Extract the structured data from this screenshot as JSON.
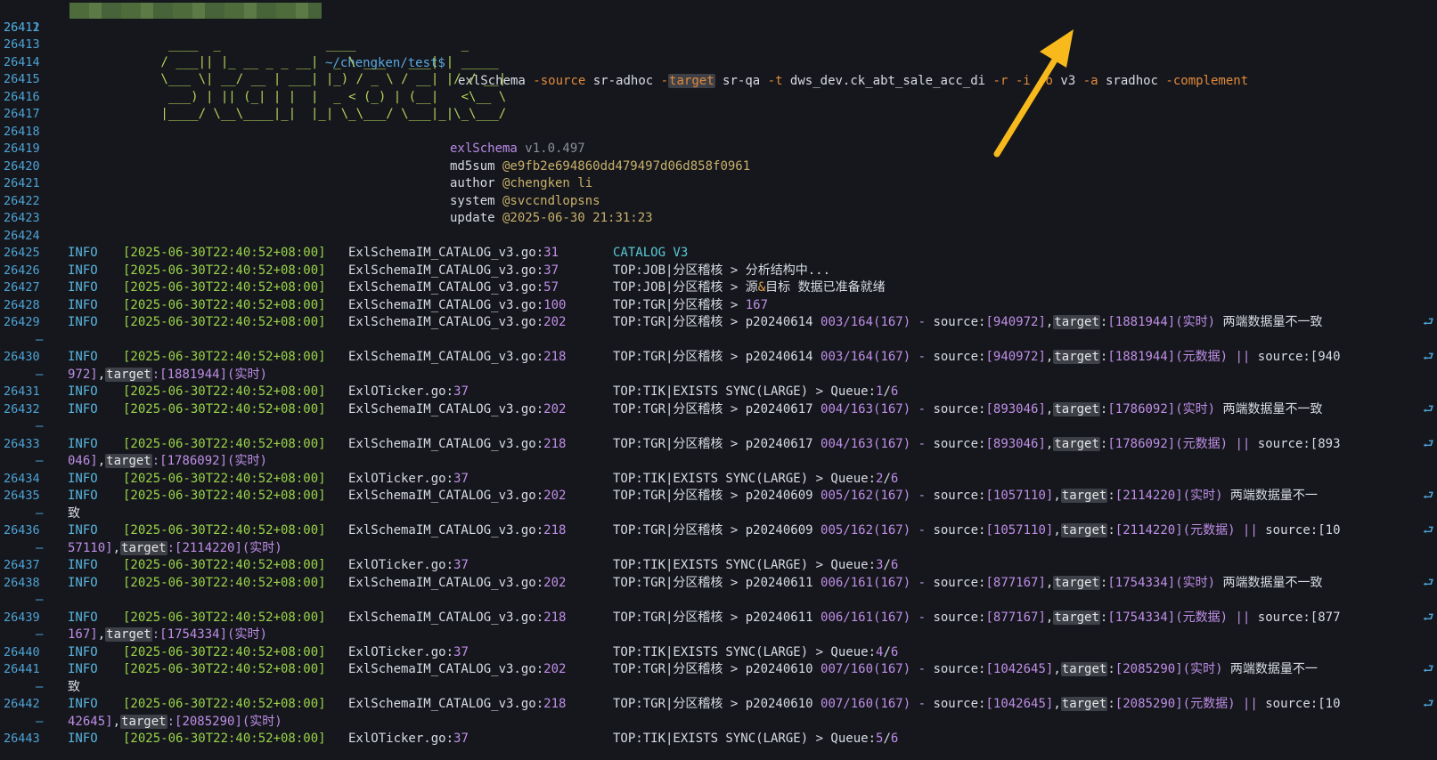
{
  "command": {
    "line_no": "26411",
    "cwd": "~/chengken/test$",
    "cmd": "exlSchema",
    "parts": [
      {
        "t": "-source",
        "c": "opt"
      },
      {
        "t": " sr-adhoc ",
        "c": "kw"
      },
      {
        "t": "-",
        "c": "opt"
      },
      {
        "t": "target",
        "c": "hl opt"
      },
      {
        "t": " sr-qa ",
        "c": "kw"
      },
      {
        "t": "-t",
        "c": "opt"
      },
      {
        "t": " dws_dev.ck_abt_sale_acc_di ",
        "c": "kw"
      },
      {
        "t": "-r",
        "c": "opt"
      },
      {
        "t": " ",
        "c": "kw"
      },
      {
        "t": "-i",
        "c": "opt"
      },
      {
        "t": " ",
        "c": "kw"
      },
      {
        "t": "-o",
        "c": "opt"
      },
      {
        "t": " v3 ",
        "c": "kw"
      },
      {
        "t": "-a",
        "c": "opt"
      },
      {
        "t": " sradhoc ",
        "c": "kw"
      },
      {
        "t": "-complement",
        "c": "opt"
      }
    ]
  },
  "banner": {
    "line_nos": [
      "26412",
      "26413",
      "26414",
      "26415",
      "26416",
      "26417",
      "26418"
    ],
    "art": [
      "",
      "  ____  _              ____              _",
      " / ___|| |_ __ _ _ __|  _ \\ ___   ___| | _____",
      " \\___ \\| __/ __ | ___| |_) / _ \\ / __| |/ / __|",
      "  ___) | || (_| | |  |  _ < (_) | (__|   <\\__ \\",
      " |____/ \\__\\____|_|  |_| \\_\\___/ \\___|_|\\_\\___/",
      ""
    ]
  },
  "meta": [
    {
      "no": "26419",
      "key": "exlSchema",
      "val": " v1.0.497"
    },
    {
      "no": "26420",
      "key": "md5sum",
      "val": " @e9fb2e694860dd479497d06d858f0961"
    },
    {
      "no": "26421",
      "key": "author",
      "val": " @chengken li"
    },
    {
      "no": "26422",
      "key": "system",
      "val": " @svccndlopsns"
    },
    {
      "no": "26423",
      "key": "update",
      "val": " @2025-06-30 21:31:23"
    },
    {
      "no": "26424",
      "key": "",
      "val": ""
    }
  ],
  "log": {
    "level": "INFO",
    "ts": "[2025-06-30T22:40:52+08:00]",
    "rows": [
      {
        "no": "26425",
        "file": "ExlSchemaIM_CATALOG_v3.go",
        "line": "31",
        "msg": [
          {
            "t": "CATALOG V3",
            "c": "cyan"
          }
        ]
      },
      {
        "no": "26426",
        "file": "ExlSchemaIM_CATALOG_v3.go",
        "line": "37",
        "msg": [
          {
            "t": "TOP:JOB|分区稽核 > 分析结构中...",
            "c": "kw"
          }
        ]
      },
      {
        "no": "26427",
        "file": "ExlSchemaIM_CATALOG_v3.go",
        "line": "57",
        "msg": [
          {
            "t": "TOP:JOB|分区稽核 > 源",
            "c": "kw"
          },
          {
            "t": "&",
            "c": "orange"
          },
          {
            "t": "目标 数据已准备就绪",
            "c": "kw"
          }
        ]
      },
      {
        "no": "26428",
        "file": "ExlSchemaIM_CATALOG_v3.go",
        "line": "100",
        "msg": [
          {
            "t": "TOP:TGR|分区稽核 > ",
            "c": "kw"
          },
          {
            "t": "167",
            "c": "num"
          }
        ]
      },
      {
        "no": "26429",
        "file": "ExlSchemaIM_CATALOG_v3.go",
        "line": "202",
        "msg": [
          {
            "t": "TOP:TGR|分区稽核 > p20240614 ",
            "c": "kw"
          },
          {
            "t": "003/164(167) - ",
            "c": "num"
          },
          {
            "t": "source:",
            "c": "kw"
          },
          {
            "t": "[940972]",
            "c": "num"
          },
          {
            "t": ",",
            "c": "kw"
          },
          {
            "t": "target",
            "c": "hl"
          },
          {
            "t": ":",
            "c": "kw"
          },
          {
            "t": "[1881944](实时)",
            "c": "num"
          },
          {
            "t": " 两端数据量不一致",
            "c": "kw"
          }
        ],
        "wrap": "dash"
      },
      {
        "no": "26430",
        "file": "ExlSchemaIM_CATALOG_v3.go",
        "line": "218",
        "msg": [
          {
            "t": "TOP:TGR|分区稽核 > p20240614 ",
            "c": "kw"
          },
          {
            "t": "003/164(167) - ",
            "c": "num"
          },
          {
            "t": "source:",
            "c": "kw"
          },
          {
            "t": "[940972]",
            "c": "num"
          },
          {
            "t": ",",
            "c": "kw"
          },
          {
            "t": "target",
            "c": "hl"
          },
          {
            "t": ":",
            "c": "kw"
          },
          {
            "t": "[1881944](元数据) || ",
            "c": "num"
          },
          {
            "t": "source:[940",
            "c": "kw"
          }
        ],
        "cont": [
          {
            "t": "972]",
            "c": "num"
          },
          {
            "t": ",",
            "c": "kw"
          },
          {
            "t": "target",
            "c": "hl"
          },
          {
            "t": ":[1881944](实时)",
            "c": "num"
          }
        ]
      },
      {
        "no": "26431",
        "file": "ExlOTicker.go",
        "line": "37",
        "msg": [
          {
            "t": "TOP:TIK|EXISTS SYNC(LARGE) > Queue:",
            "c": "kw"
          },
          {
            "t": "1",
            "c": "num"
          },
          {
            "t": "/",
            "c": "kw"
          },
          {
            "t": "6",
            "c": "num"
          }
        ]
      },
      {
        "no": "26432",
        "file": "ExlSchemaIM_CATALOG_v3.go",
        "line": "202",
        "msg": [
          {
            "t": "TOP:TGR|分区稽核 > p20240617 ",
            "c": "kw"
          },
          {
            "t": "004/163(167) - ",
            "c": "num"
          },
          {
            "t": "source:",
            "c": "kw"
          },
          {
            "t": "[893046]",
            "c": "num"
          },
          {
            "t": ",",
            "c": "kw"
          },
          {
            "t": "target",
            "c": "hl"
          },
          {
            "t": ":",
            "c": "kw"
          },
          {
            "t": "[1786092](实时)",
            "c": "num"
          },
          {
            "t": " 两端数据量不一致",
            "c": "kw"
          }
        ],
        "wrap": "dash"
      },
      {
        "no": "26433",
        "file": "ExlSchemaIM_CATALOG_v3.go",
        "line": "218",
        "msg": [
          {
            "t": "TOP:TGR|分区稽核 > p20240617 ",
            "c": "kw"
          },
          {
            "t": "004/163(167) - ",
            "c": "num"
          },
          {
            "t": "source:",
            "c": "kw"
          },
          {
            "t": "[893046]",
            "c": "num"
          },
          {
            "t": ",",
            "c": "kw"
          },
          {
            "t": "target",
            "c": "hl"
          },
          {
            "t": ":",
            "c": "kw"
          },
          {
            "t": "[1786092](元数据) || ",
            "c": "num"
          },
          {
            "t": "source:[893",
            "c": "kw"
          }
        ],
        "cont": [
          {
            "t": "046]",
            "c": "num"
          },
          {
            "t": ",",
            "c": "kw"
          },
          {
            "t": "target",
            "c": "hl"
          },
          {
            "t": ":[1786092](实时)",
            "c": "num"
          }
        ]
      },
      {
        "no": "26434",
        "file": "ExlOTicker.go",
        "line": "37",
        "msg": [
          {
            "t": "TOP:TIK|EXISTS SYNC(LARGE) > Queue:",
            "c": "kw"
          },
          {
            "t": "2",
            "c": "num"
          },
          {
            "t": "/",
            "c": "kw"
          },
          {
            "t": "6",
            "c": "num"
          }
        ]
      },
      {
        "no": "26435",
        "file": "ExlSchemaIM_CATALOG_v3.go",
        "line": "202",
        "msg": [
          {
            "t": "TOP:TGR|分区稽核 > p20240609 ",
            "c": "kw"
          },
          {
            "t": "005/162(167) - ",
            "c": "num"
          },
          {
            "t": "source:",
            "c": "kw"
          },
          {
            "t": "[1057110]",
            "c": "num"
          },
          {
            "t": ",",
            "c": "kw"
          },
          {
            "t": "target",
            "c": "hl"
          },
          {
            "t": ":",
            "c": "kw"
          },
          {
            "t": "[2114220](实时)",
            "c": "num"
          },
          {
            "t": " 两端数据量不一",
            "c": "kw"
          }
        ],
        "cont": [
          {
            "t": "致",
            "c": "kw"
          }
        ]
      },
      {
        "no": "26436",
        "file": "ExlSchemaIM_CATALOG_v3.go",
        "line": "218",
        "msg": [
          {
            "t": "TOP:TGR|分区稽核 > p20240609 ",
            "c": "kw"
          },
          {
            "t": "005/162(167) - ",
            "c": "num"
          },
          {
            "t": "source:",
            "c": "kw"
          },
          {
            "t": "[1057110]",
            "c": "num"
          },
          {
            "t": ",",
            "c": "kw"
          },
          {
            "t": "target",
            "c": "hl"
          },
          {
            "t": ":",
            "c": "kw"
          },
          {
            "t": "[2114220](元数据) || ",
            "c": "num"
          },
          {
            "t": "source:[10",
            "c": "kw"
          }
        ],
        "cont": [
          {
            "t": "57110]",
            "c": "num"
          },
          {
            "t": ",",
            "c": "kw"
          },
          {
            "t": "target",
            "c": "hl"
          },
          {
            "t": ":[2114220](实时)",
            "c": "num"
          }
        ]
      },
      {
        "no": "26437",
        "file": "ExlOTicker.go",
        "line": "37",
        "msg": [
          {
            "t": "TOP:TIK|EXISTS SYNC(LARGE) > Queue:",
            "c": "kw"
          },
          {
            "t": "3",
            "c": "num"
          },
          {
            "t": "/",
            "c": "kw"
          },
          {
            "t": "6",
            "c": "num"
          }
        ]
      },
      {
        "no": "26438",
        "file": "ExlSchemaIM_CATALOG_v3.go",
        "line": "202",
        "msg": [
          {
            "t": "TOP:TGR|分区稽核 > p20240611 ",
            "c": "kw"
          },
          {
            "t": "006/161(167) - ",
            "c": "num"
          },
          {
            "t": "source:",
            "c": "kw"
          },
          {
            "t": "[877167]",
            "c": "num"
          },
          {
            "t": ",",
            "c": "kw"
          },
          {
            "t": "target",
            "c": "hl"
          },
          {
            "t": ":",
            "c": "kw"
          },
          {
            "t": "[1754334](实时)",
            "c": "num"
          },
          {
            "t": " 两端数据量不一致",
            "c": "kw"
          }
        ],
        "wrap": "dash"
      },
      {
        "no": "26439",
        "file": "ExlSchemaIM_CATALOG_v3.go",
        "line": "218",
        "msg": [
          {
            "t": "TOP:TGR|分区稽核 > p20240611 ",
            "c": "kw"
          },
          {
            "t": "006/161(167) - ",
            "c": "num"
          },
          {
            "t": "source:",
            "c": "kw"
          },
          {
            "t": "[877167]",
            "c": "num"
          },
          {
            "t": ",",
            "c": "kw"
          },
          {
            "t": "target",
            "c": "hl"
          },
          {
            "t": ":",
            "c": "kw"
          },
          {
            "t": "[1754334](元数据) || ",
            "c": "num"
          },
          {
            "t": "source:[877",
            "c": "kw"
          }
        ],
        "cont": [
          {
            "t": "167]",
            "c": "num"
          },
          {
            "t": ",",
            "c": "kw"
          },
          {
            "t": "target",
            "c": "hl"
          },
          {
            "t": ":[1754334](实时)",
            "c": "num"
          }
        ]
      },
      {
        "no": "26440",
        "file": "ExlOTicker.go",
        "line": "37",
        "msg": [
          {
            "t": "TOP:TIK|EXISTS SYNC(LARGE) > Queue:",
            "c": "kw"
          },
          {
            "t": "4",
            "c": "num"
          },
          {
            "t": "/",
            "c": "kw"
          },
          {
            "t": "6",
            "c": "num"
          }
        ]
      },
      {
        "no": "26441",
        "file": "ExlSchemaIM_CATALOG_v3.go",
        "line": "202",
        "msg": [
          {
            "t": "TOP:TGR|分区稽核 > p20240610 ",
            "c": "kw"
          },
          {
            "t": "007/160(167) - ",
            "c": "num"
          },
          {
            "t": "source:",
            "c": "kw"
          },
          {
            "t": "[1042645]",
            "c": "num"
          },
          {
            "t": ",",
            "c": "kw"
          },
          {
            "t": "target",
            "c": "hl"
          },
          {
            "t": ":",
            "c": "kw"
          },
          {
            "t": "[2085290](实时)",
            "c": "num"
          },
          {
            "t": " 两端数据量不一",
            "c": "kw"
          }
        ],
        "cont": [
          {
            "t": "致",
            "c": "kw"
          }
        ]
      },
      {
        "no": "26442",
        "file": "ExlSchemaIM_CATALOG_v3.go",
        "line": "218",
        "msg": [
          {
            "t": "TOP:TGR|分区稽核 > p20240610 ",
            "c": "kw"
          },
          {
            "t": "007/160(167) - ",
            "c": "num"
          },
          {
            "t": "source:",
            "c": "kw"
          },
          {
            "t": "[1042645]",
            "c": "num"
          },
          {
            "t": ",",
            "c": "kw"
          },
          {
            "t": "target",
            "c": "hl"
          },
          {
            "t": ":",
            "c": "kw"
          },
          {
            "t": "[2085290](元数据) || ",
            "c": "num"
          },
          {
            "t": "source:[10",
            "c": "kw"
          }
        ],
        "cont": [
          {
            "t": "42645]",
            "c": "num"
          },
          {
            "t": ",",
            "c": "kw"
          },
          {
            "t": "target",
            "c": "hl"
          },
          {
            "t": ":[2085290](实时)",
            "c": "num"
          }
        ]
      },
      {
        "no": "26443",
        "file": "ExlOTicker.go",
        "line": "37",
        "msg": [
          {
            "t": "TOP:TIK|EXISTS SYNC(LARGE) > Queue:",
            "c": "kw"
          },
          {
            "t": "5",
            "c": "num"
          },
          {
            "t": "/",
            "c": "kw"
          },
          {
            "t": "6",
            "c": "num"
          }
        ]
      }
    ]
  },
  "colors": {
    "background": "#15171c",
    "line_number": "#4ea3d6",
    "timestamp": "#9bd34a",
    "number": "#c08ee8",
    "option": "#e08a3c",
    "arrow": "#f7b91c"
  }
}
